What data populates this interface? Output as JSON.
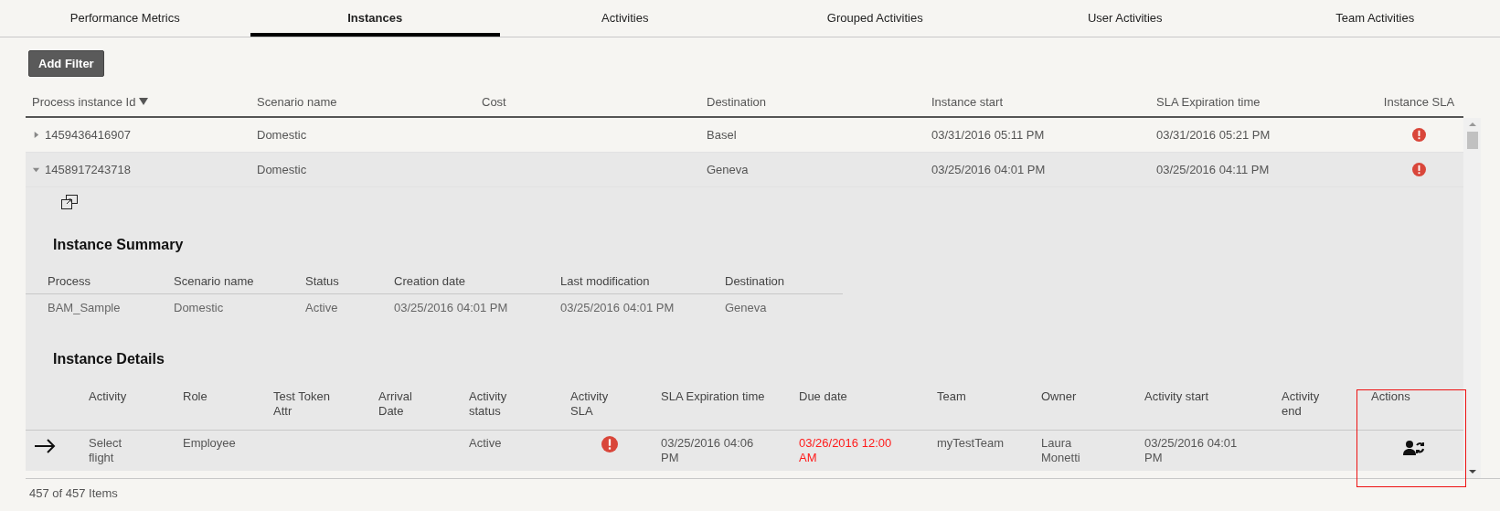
{
  "tabs": [
    {
      "label": "Performance Metrics",
      "selected": false
    },
    {
      "label": "Instances",
      "selected": true
    },
    {
      "label": "Activities",
      "selected": false
    },
    {
      "label": "Grouped Activities",
      "selected": false
    },
    {
      "label": "User Activities",
      "selected": false
    },
    {
      "label": "Team Activities",
      "selected": false
    }
  ],
  "toolbar": {
    "add_filter": "Add Filter"
  },
  "table": {
    "columns": [
      {
        "label": "Process instance Id",
        "sorted": true
      },
      {
        "label": "Scenario name",
        "sorted": false
      },
      {
        "label": "Cost",
        "sorted": false
      },
      {
        "label": "Destination",
        "sorted": false
      },
      {
        "label": "Instance start",
        "sorted": false
      },
      {
        "label": "SLA Expiration time",
        "sorted": false
      },
      {
        "label": "Instance SLA",
        "sorted": false
      }
    ],
    "rows": [
      {
        "id": "1459436416907",
        "scenario": "Domestic",
        "destination": "Basel",
        "instance_start": "03/31/2016 05:11 PM",
        "sla_expiration": "03/31/2016 05:21 PM",
        "sla_breached": true,
        "expanded": false
      },
      {
        "id": "1458917243718",
        "scenario": "Domestic",
        "destination": "Geneva",
        "instance_start": "03/25/2016 04:01 PM",
        "sla_expiration": "03/25/2016 04:11 PM",
        "sla_breached": true,
        "expanded": true,
        "detail": {
          "summary_title": "Instance Summary",
          "summary_columns": [
            "Process",
            "Scenario name",
            "Status",
            "Creation date",
            "Last modification",
            "Destination"
          ],
          "summary_row": [
            "BAM_Sample",
            "Domestic",
            "Active",
            "03/25/2016 04:01 PM",
            "03/25/2016 04:01 PM",
            "Geneva"
          ],
          "details_title": "Instance Details",
          "details_columns": [
            "Activity",
            "Role",
            "Test Token Attr",
            "Arrival Date",
            "Activity status",
            "Activity SLA",
            "SLA Expiration time",
            "Due date",
            "Team",
            "Owner",
            "Activity start",
            "Activity end",
            "Actions"
          ],
          "details_rows": [
            {
              "activity": "Select flight",
              "role": "Employee",
              "activity_status": "Active",
              "sla_breached": true,
              "sla_expiration": "03/25/2016 04:06 PM",
              "due_date": "03/26/2016 12:00 AM",
              "overdue": true,
              "team": "myTestTeam",
              "owner": "Laura Monetti",
              "activity_start": "03/25/2016 04:01 PM",
              "current": true
            }
          ]
        }
      }
    ]
  },
  "footer": "457 of 457 Items"
}
